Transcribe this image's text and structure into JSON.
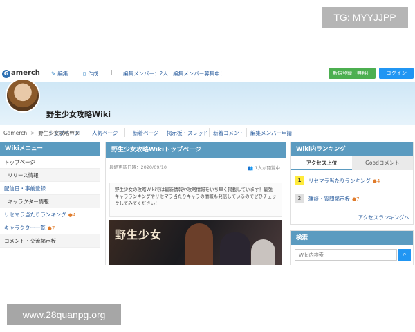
{
  "watermarks": {
    "top": "TG: MYYJJPP",
    "bottom": "www.28quanpg.org"
  },
  "topbar": {
    "logo_letter": "G",
    "logo_text": "amerch",
    "edit_label": "編集",
    "create_label": "作成",
    "separator": "|",
    "members_text": "編集メンバー：2人　編集メンバー募集中！",
    "register_label": "新規登録（無料）",
    "login_label": "ログイン"
  },
  "header": {
    "site_title": "野生少女攻略Wiki",
    "nav": [
      "トップページ",
      "人気ページ",
      "新着ページ",
      "掲示板・スレッド",
      "新着コメント",
      "編集メンバー申請"
    ]
  },
  "breadcrumb": {
    "home": "Gamerch",
    "separator": ">",
    "current": "野生少女攻略Wiki"
  },
  "left_menu": {
    "title": "Wikiメニュー",
    "items": [
      {
        "label": "トップページ",
        "badge": ""
      },
      {
        "label": "リリース情報",
        "badge": ""
      },
      {
        "label": "配信日・事前登録",
        "badge": ""
      },
      {
        "label": "キャラクター情報",
        "badge": ""
      },
      {
        "label": "リセマラ当たりランキング",
        "badge": "4"
      },
      {
        "label": "キャラクター一覧",
        "badge": "7"
      },
      {
        "label": "コメント・交流掲示板",
        "badge": ""
      }
    ]
  },
  "main": {
    "title": "野生少女攻略Wikiトップページ",
    "updated": "最終更新日時：2020/09/10",
    "viewers": "1人が閲覧中",
    "intro": "野生少女の攻略Wikiでは最新情報や攻略情報をいち早く掲載しています！最強キャラランキングやリセマラ当たりキャラの情報も発信しているのでぜひチェックしてみてください！",
    "banner_title": "野生少女"
  },
  "ranking": {
    "title": "Wiki内ランキング",
    "tab_active": "アクセス上位",
    "tab_inactive": "Goodコメント",
    "rows": [
      {
        "rank": "1",
        "label": "リセマラ当たりランキング",
        "badge": "4"
      },
      {
        "rank": "2",
        "label": "雑談・質問掲示板",
        "badge": "7"
      }
    ],
    "more": "アクセスランキングへ"
  },
  "search": {
    "title": "検索",
    "placeholder": "Wiki内検索"
  },
  "colors": {
    "panel_header": "#5b9bc0",
    "register_button": "#4caf50",
    "login_button": "#2196f3",
    "rank_first": "#ffeb3b"
  },
  "icons": [
    "pencil-icon",
    "document-icon",
    "avatar",
    "people-icon",
    "comment-icon",
    "search-icon"
  ]
}
